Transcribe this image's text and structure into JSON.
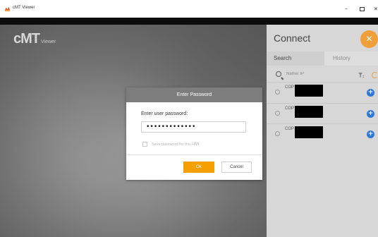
{
  "window": {
    "title": "cMT Viewer",
    "app_icon": "cmt-app-icon",
    "min_glyph": "–",
    "close_glyph": "✕"
  },
  "logo": {
    "main": "cMT",
    "sub": "Viewer"
  },
  "connect": {
    "title": "Connect",
    "close_glyph": "✕",
    "tabs": [
      {
        "label": "Search",
        "active": true
      },
      {
        "label": "History",
        "active": false
      }
    ],
    "search_placeholder": "Name/ IP",
    "devices": [
      {
        "name": "COP"
      },
      {
        "name": "COP"
      },
      {
        "name": "COP"
      }
    ],
    "add_glyph": "+"
  },
  "dialog": {
    "title": "Enter Password",
    "prompt": "Enter user password:",
    "password_value": "•••••••••••••",
    "save_label": "Save password for this HMI",
    "save_checked": false,
    "ok_label": "Ok",
    "cancel_label": "Cancel"
  },
  "colors": {
    "accent_orange": "#f5a000",
    "add_blue": "#2f78d6",
    "header_gray": "#7d7d7d",
    "panel_gray": "#d7d7d7"
  }
}
